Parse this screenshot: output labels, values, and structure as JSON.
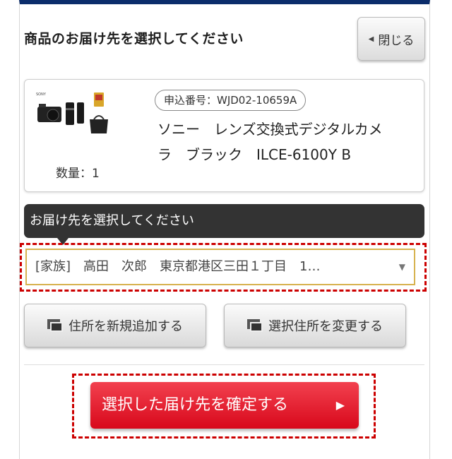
{
  "header": {
    "title": "商品のお届け先を選択してください",
    "close_label": "閉じる"
  },
  "product": {
    "order_number": "申込番号：WJD02-10659A",
    "name_line1": "ソニー　レンズ交換式デジタルカメ",
    "name_line2": "ラ　ブラック　ILCE-6100Y B",
    "quantity": "数量：1"
  },
  "tooltip": {
    "text": "お届け先を選択してください"
  },
  "address_select": {
    "value": "[家族]　高田　次郎　東京都港区三田１丁目　1…"
  },
  "buttons": {
    "add_address": "住所を新規追加する",
    "change_address": "選択住所を変更する",
    "confirm": "選択した届け先を確定する"
  },
  "colors": {
    "accent_red": "#d8081b",
    "header_border": "#0b2d6b",
    "tooltip_bg": "#333333",
    "select_border": "#d7b24f"
  },
  "icons": {
    "close": "triangle-left-icon",
    "caret": "caret-down-icon",
    "address": "address-card-icon",
    "confirm": "play-arrow-icon"
  }
}
